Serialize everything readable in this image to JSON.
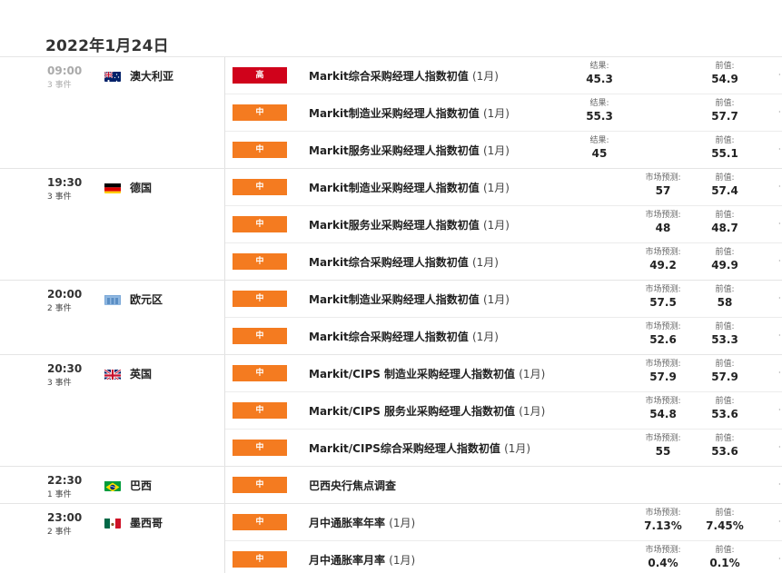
{
  "date": "2022年1月24日",
  "labels": {
    "result": "结果:",
    "forecast": "市场预测:",
    "previous": "前值:"
  },
  "groups": [
    {
      "time": "09:00",
      "count": "3 事件",
      "past": true,
      "country": "澳大利亚",
      "flag_icon": "australia-flag-icon",
      "events": [
        {
          "importance": "高",
          "level": "high",
          "name": "Markit综合采购经理人指数初值",
          "period": "(1月)",
          "result": "45.3",
          "forecast": "",
          "previous": "54.9"
        },
        {
          "importance": "中",
          "level": "mid",
          "name": "Markit制造业采购经理人指数初值",
          "period": "(1月)",
          "result": "55.3",
          "forecast": "",
          "previous": "57.7"
        },
        {
          "importance": "中",
          "level": "mid",
          "name": "Markit服务业采购经理人指数初值",
          "period": "(1月)",
          "result": "45",
          "forecast": "",
          "previous": "55.1"
        }
      ]
    },
    {
      "time": "19:30",
      "count": "3 事件",
      "past": false,
      "country": "德国",
      "flag_icon": "germany-flag-icon",
      "events": [
        {
          "importance": "中",
          "level": "mid",
          "name": "Markit制造业采购经理人指数初值",
          "period": "(1月)",
          "result": "",
          "forecast": "57",
          "previous": "57.4"
        },
        {
          "importance": "中",
          "level": "mid",
          "name": "Markit服务业采购经理人指数初值",
          "period": "(1月)",
          "result": "",
          "forecast": "48",
          "previous": "48.7"
        },
        {
          "importance": "中",
          "level": "mid",
          "name": "Markit综合采购经理人指数初值",
          "period": "(1月)",
          "result": "",
          "forecast": "49.2",
          "previous": "49.9"
        }
      ]
    },
    {
      "time": "20:00",
      "count": "2 事件",
      "past": false,
      "country": "欧元区",
      "flag_icon": "eurozone-flag-icon",
      "events": [
        {
          "importance": "中",
          "level": "mid",
          "name": "Markit制造业采购经理人指数初值",
          "period": "(1月)",
          "result": "",
          "forecast": "57.5",
          "previous": "58"
        },
        {
          "importance": "中",
          "level": "mid",
          "name": "Markit综合采购经理人指数初值",
          "period": "(1月)",
          "result": "",
          "forecast": "52.6",
          "previous": "53.3"
        }
      ]
    },
    {
      "time": "20:30",
      "count": "3 事件",
      "past": false,
      "country": "英国",
      "flag_icon": "uk-flag-icon",
      "events": [
        {
          "importance": "中",
          "level": "mid",
          "name": "Markit/CIPS 制造业采购经理人指数初值",
          "period": "(1月)",
          "result": "",
          "forecast": "57.9",
          "previous": "57.9"
        },
        {
          "importance": "中",
          "level": "mid",
          "name": "Markit/CIPS 服务业采购经理人指数初值",
          "period": "(1月)",
          "result": "",
          "forecast": "54.8",
          "previous": "53.6"
        },
        {
          "importance": "中",
          "level": "mid",
          "name": "Markit/CIPS综合采购经理人指数初值",
          "period": "(1月)",
          "result": "",
          "forecast": "55",
          "previous": "53.6"
        }
      ]
    },
    {
      "time": "22:30",
      "count": "1 事件",
      "past": false,
      "country": "巴西",
      "flag_icon": "brazil-flag-icon",
      "events": [
        {
          "importance": "中",
          "level": "mid",
          "name": "巴西央行焦点调查",
          "period": "",
          "result": "",
          "forecast": "",
          "previous": ""
        }
      ]
    },
    {
      "time": "23:00",
      "count": "2 事件",
      "past": false,
      "country": "墨西哥",
      "flag_icon": "mexico-flag-icon",
      "events": [
        {
          "importance": "中",
          "level": "mid",
          "name": "月中通胀率年率",
          "period": "(1月)",
          "result": "",
          "forecast": "7.13%",
          "previous": "7.45%"
        },
        {
          "importance": "中",
          "level": "mid",
          "name": "月中通胀率月率",
          "period": "(1月)",
          "result": "",
          "forecast": "0.4%",
          "previous": "0.1%"
        }
      ]
    }
  ]
}
